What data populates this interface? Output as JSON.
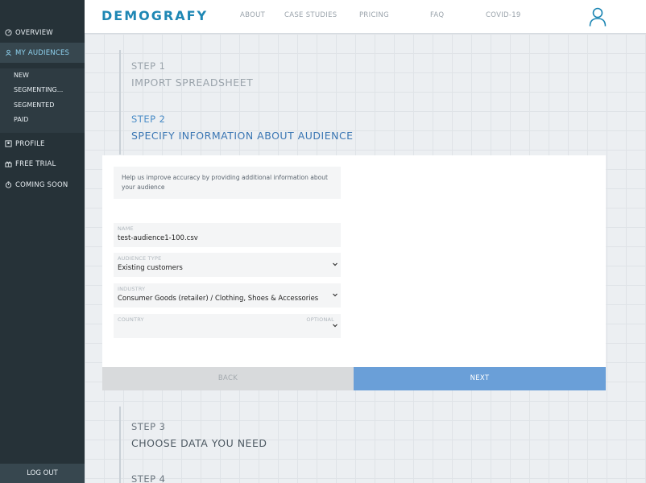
{
  "sidebar": {
    "overview": "OVERVIEW",
    "my_audiences": "MY AUDIENCES",
    "sub_items": [
      "NEW",
      "SEGMENTING...",
      "SEGMENTED",
      "PAID"
    ],
    "profile": "PROFILE",
    "free_trial": "FREE TRIAL",
    "coming_soon": "COMING SOON",
    "logout": "LOG OUT"
  },
  "header": {
    "logo": "DEMOGRAFY",
    "nav": [
      "ABOUT",
      "CASE STUDIES",
      "PRICING",
      "FAQ",
      "COVID-19"
    ]
  },
  "steps": [
    {
      "number": "STEP 1",
      "title": "IMPORT SPREADSHEET"
    },
    {
      "number": "STEP 2",
      "title": "SPECIFY INFORMATION ABOUT AUDIENCE"
    },
    {
      "number": "STEP 3",
      "title": "CHOOSE DATA YOU NEED"
    },
    {
      "number": "STEP 4",
      "title": ""
    }
  ],
  "form": {
    "info": "Help us improve accuracy by providing additional information about your audience",
    "name_label": "NAME",
    "name_value": "test-audience1-100.csv",
    "audience_type_label": "AUDIENCE TYPE",
    "audience_type_value": "Existing customers",
    "industry_label": "INDUSTRY",
    "industry_value": "Consumer Goods (retailer) / Clothing, Shoes & Accessories",
    "country_label": "COUNTRY",
    "country_optional": "OPTIONAL",
    "country_value": ""
  },
  "buttons": {
    "back": "BACK",
    "next": "NEXT"
  },
  "colors": {
    "sidebar_bg": "#263238",
    "accent": "#1e87b4",
    "next_button": "#6a9fd8",
    "active_step": "#3a76b3"
  }
}
